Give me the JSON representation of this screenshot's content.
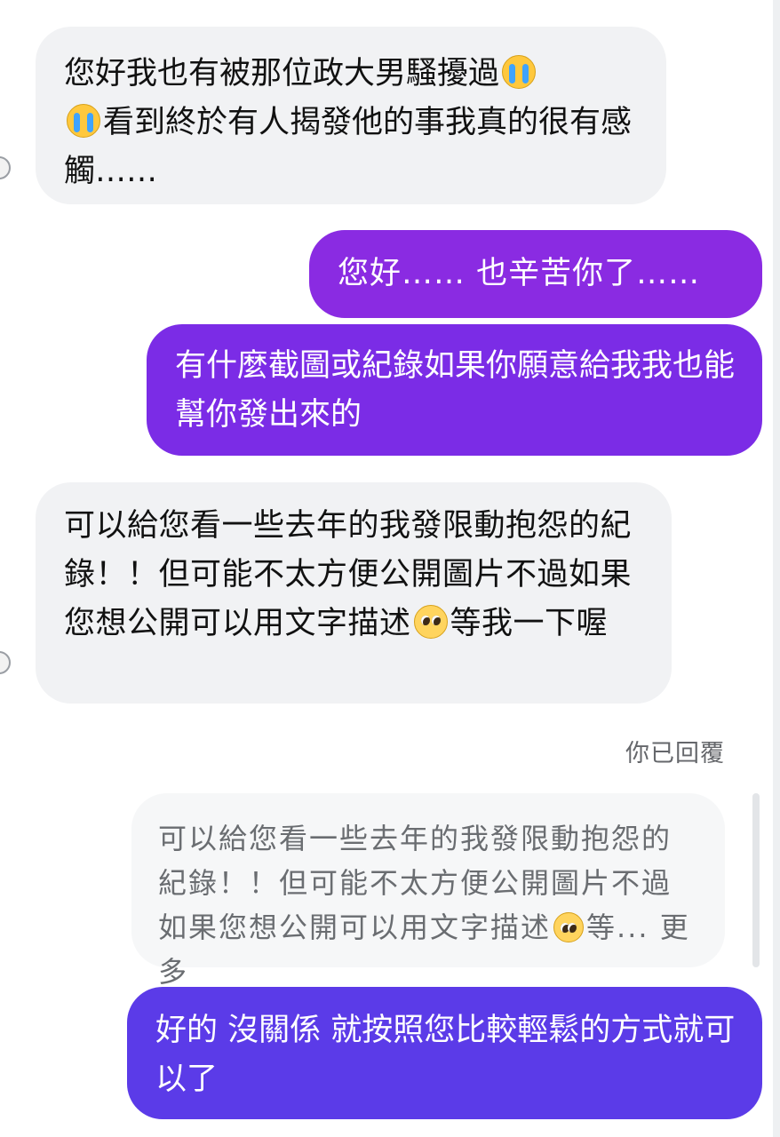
{
  "conversation": {
    "messages": [
      {
        "sender": "them",
        "parts": [
          "您好我也有被那位政大男騷擾過",
          "cry-emoji",
          "",
          "cry-emoji",
          "看到終於有人揭發他的事我真的很有感觸……"
        ]
      },
      {
        "sender": "me",
        "text": "您好…… 也辛苦你了……"
      },
      {
        "sender": "me",
        "text": "有什麼截圖或紀錄如果你願意給我我也能幫你發出來的"
      },
      {
        "sender": "them",
        "parts": [
          "可以給您看一些去年的我發限動抱怨的紀錄！！但可能不太方便公開圖片不過如果您想公開可以用文字描述",
          "pleading-emoji",
          "等我一下喔"
        ]
      }
    ],
    "reply_label": "你已回覆",
    "quoted_reply": {
      "text_before_emoji": "可以給您看一些去年的我發限動抱怨的紀錄！！但可能不太方便公開圖片不過如果您想公開可以用文字描述",
      "emoji": "pleading-emoji",
      "text_after_emoji": "等...",
      "more_label": "更多"
    },
    "final_message": {
      "sender": "me",
      "text": "好的 沒關係 就按照您比較輕鬆的方式就可以了"
    }
  },
  "colors": {
    "incoming_bubble": "#f1f2f4",
    "outgoing_purple_top": "#8a2be2",
    "outgoing_purple_mid": "#7b2ce6",
    "outgoing_purple_bottom": "#5b3be8",
    "quoted_bubble": "#f6f7f8",
    "meta_text": "#65676b"
  }
}
